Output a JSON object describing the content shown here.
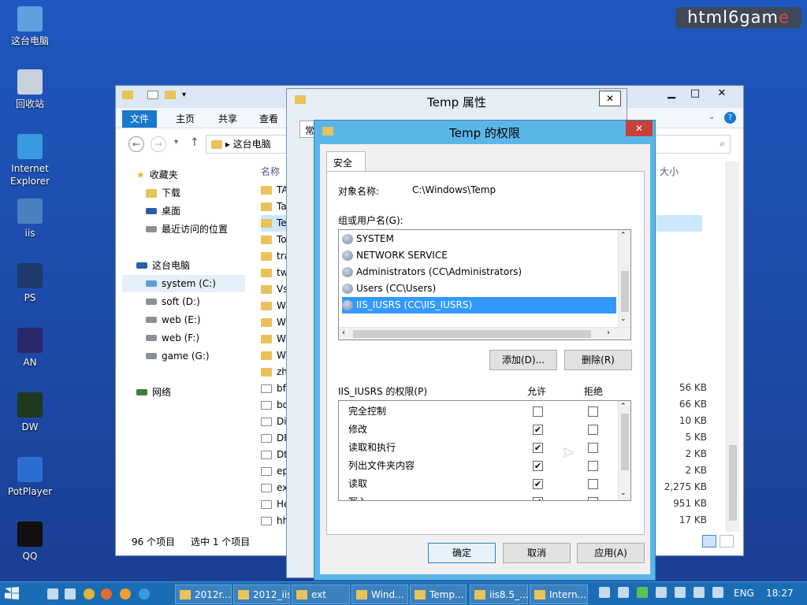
{
  "watermark": {
    "text": "html6gam",
    "accent": "e"
  },
  "desktop_icons": [
    {
      "label": "这台电脑",
      "icon": "computer-icon"
    },
    {
      "label": "回收站",
      "icon": "recycle-bin-icon"
    },
    {
      "label": "Internet Explorer",
      "icon": "ie-icon"
    },
    {
      "label": "iis",
      "icon": "iis-icon"
    },
    {
      "label": "PS",
      "icon": "photoshop-icon"
    },
    {
      "label": "AN",
      "icon": "animate-icon"
    },
    {
      "label": "DW",
      "icon": "dreamweaver-icon"
    },
    {
      "label": "PotPlayer",
      "icon": "potplayer-icon"
    },
    {
      "label": "QQ",
      "icon": "qq-icon"
    }
  ],
  "explorer": {
    "tabs": [
      "文件",
      "主页",
      "共享",
      "查看"
    ],
    "breadcrumb": "这台电脑",
    "sidebar": {
      "favorites_label": "收藏夹",
      "favorites": [
        "下载",
        "桌面",
        "最近访问的位置"
      ],
      "computer_label": "这台电脑",
      "drives": [
        "system (C:)",
        "soft (D:)",
        "web (E:)",
        "web (F:)",
        "game (G:)"
      ],
      "network_label": "网络"
    },
    "col_name": "名称",
    "col_size": "大小",
    "rows": [
      "TA",
      "Ta",
      "Te",
      "To",
      "tra",
      "tw",
      "Vs",
      "W",
      "W",
      "W",
      "W",
      "zh",
      "bf",
      "bo",
      "Di",
      "DF",
      "Dt",
      "ep",
      "ex",
      "He",
      "hh"
    ],
    "sizes": [
      "56 KB",
      "66 KB",
      "10 KB",
      "5 KB",
      "2 KB",
      "2 KB",
      "2,275 KB",
      "951 KB",
      "17 KB"
    ],
    "status_count": "96 个项目",
    "status_selected": "选中 1 个项目"
  },
  "props": {
    "title": "Temp 属性",
    "tab_partial": "常"
  },
  "perm": {
    "title": "Temp 的权限",
    "tab": "安全",
    "object_label": "对象名称:",
    "object_value": "C:\\Windows\\Temp",
    "group_label": "组或用户名(G):",
    "users": [
      "SYSTEM",
      "NETWORK SERVICE",
      "Administrators (CC\\Administrators)",
      "Users (CC\\Users)",
      "IIS_IUSRS (CC\\IIS_IUSRS)"
    ],
    "selected_user_index": 4,
    "add_button": "添加(D)...",
    "remove_button": "删除(R)",
    "perm_label": "IIS_IUSRS 的权限(P)",
    "allow_label": "允许",
    "deny_label": "拒绝",
    "permissions": [
      {
        "name": "完全控制",
        "allow": false,
        "deny": false
      },
      {
        "name": "修改",
        "allow": true,
        "deny": false
      },
      {
        "name": "读取和执行",
        "allow": true,
        "deny": false
      },
      {
        "name": "列出文件夹内容",
        "allow": true,
        "deny": false
      },
      {
        "name": "读取",
        "allow": true,
        "deny": false
      },
      {
        "name": "写入",
        "allow": true,
        "deny": false
      }
    ],
    "ok": "确定",
    "cancel": "取消",
    "apply": "应用(A)"
  },
  "taskbar": {
    "items": [
      "2012r...",
      "2012_iis",
      "ext",
      "Wind...",
      "Temp...",
      "iis8.5_...",
      "Intern..."
    ],
    "lang": "ENG",
    "time": "18:27"
  },
  "colors": {
    "accent": "#1979ca",
    "selection": "#3399ff",
    "close": "#c7413a"
  }
}
